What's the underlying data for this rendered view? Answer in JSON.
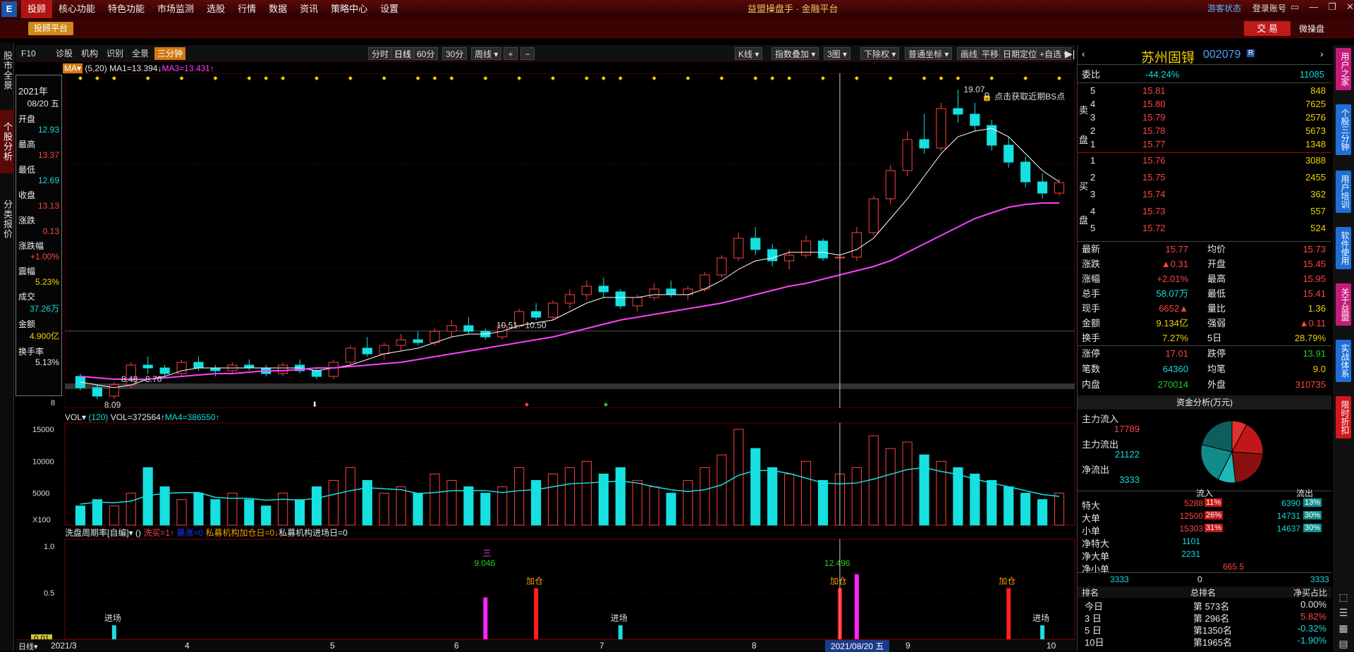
{
  "menubar": {
    "items": [
      "投顾",
      "核心功能",
      "特色功能",
      "市场监测",
      "选股",
      "行情",
      "数据",
      "资讯",
      "策略中心",
      "设置"
    ],
    "title": "益盟操盘手 · 金融平台",
    "guest": "游客状态",
    "login": "登录账号"
  },
  "subbar": {
    "platform": "投顾平台",
    "trade": "交 易",
    "micro": "微操盘"
  },
  "lefttabs": [
    "股市全景",
    "个股分析",
    "分类报价"
  ],
  "toolbar": {
    "left": [
      "F10",
      "诊股",
      "机构",
      "识别",
      "全景",
      "三分钟"
    ],
    "periods": [
      "分时",
      "日线",
      "60分",
      "30分",
      "周线 ▾"
    ],
    "zoom": [
      "+",
      "−"
    ],
    "right": [
      "K线 ▾",
      "指数叠加 ▾",
      "3图 ▾",
      "下除权 ▾",
      "普通坐标 ▾",
      "画线",
      "平移",
      "日期定位",
      "+自选 ▾"
    ]
  },
  "mainchart": {
    "indicator": "MA▾",
    "params": "(5,20)",
    "ma1": "MA1=13.394↓",
    "ma3": "MA3=13.431↑",
    "high_label": "19.07",
    "low_label": "8.09",
    "range1": "8.48 - 8.70",
    "range2": "10.51 - 10.50",
    "bs_tip": "点击获取近期BS点",
    "bottom_tick": "8"
  },
  "infobox": {
    "year": "2021年",
    "date": "08/20 五",
    "fields": [
      {
        "label": "开盘",
        "value": "12.93",
        "cls": "dn"
      },
      {
        "label": "最高",
        "value": "13.37",
        "cls": "up"
      },
      {
        "label": "最低",
        "value": "12.69",
        "cls": "dn"
      },
      {
        "label": "收盘",
        "value": "13.13",
        "cls": "up"
      },
      {
        "label": "涨跌",
        "value": "0.13",
        "cls": "up"
      },
      {
        "label": "涨跌幅",
        "value": "+1.00%",
        "cls": "up"
      },
      {
        "label": "震幅",
        "value": "5.23%",
        "cls": "yl"
      },
      {
        "label": "成交",
        "value": "37.26万",
        "cls": "dn"
      },
      {
        "label": "金额",
        "value": "4.900亿",
        "cls": "yl"
      },
      {
        "label": "换手率",
        "value": "5.13%",
        "cls": "wh"
      }
    ]
  },
  "volpanel": {
    "indicator": "VOL▾",
    "param": "(120)",
    "vol": "VOL=372564↑",
    "ma4": "MA4=386550↑",
    "yticks": [
      "15000",
      "10000",
      "5000",
      "X100"
    ]
  },
  "oscpanel": {
    "title": "洗盘周期率[自编]▾",
    "paren": "()",
    "xm": "洗买=1↑",
    "hidden": "暴涨=0",
    "sm1": "私募机构加仓日=0↓",
    "sm2": "私募机构进场日=0",
    "yticks": [
      "1.0",
      "0.5"
    ],
    "bottom_value": "0.01",
    "label_san": "三",
    "val1": "9.046",
    "val2": "12.496",
    "jc": "加仓",
    "jinchang": "进场"
  },
  "xaxis": {
    "labels": [
      "2021/3",
      "4",
      "5",
      "6",
      "7",
      "8",
      "9",
      "10"
    ],
    "cursor": "2021/08/20 五",
    "left": "日线▾"
  },
  "quote": {
    "name": "苏州固锝",
    "code": "002079",
    "wb_label": "委比",
    "wb": "-44.24%",
    "wb_vol": "11085",
    "asks": [
      {
        "lvl": "5",
        "price": "15.81",
        "vol": "848"
      },
      {
        "lvl": "4",
        "price": "15.80",
        "vol": "7625"
      },
      {
        "lvl": "3",
        "price": "15.79",
        "vol": "2576"
      },
      {
        "lvl": "2",
        "price": "15.78",
        "vol": "5673"
      },
      {
        "lvl": "1",
        "price": "15.77",
        "vol": "1348"
      }
    ],
    "bids": [
      {
        "lvl": "1",
        "price": "15.76",
        "vol": "3088"
      },
      {
        "lvl": "2",
        "price": "15.75",
        "vol": "2455"
      },
      {
        "lvl": "3",
        "price": "15.74",
        "vol": "362"
      },
      {
        "lvl": "4",
        "price": "15.73",
        "vol": "557"
      },
      {
        "lvl": "5",
        "price": "15.72",
        "vol": "524"
      }
    ],
    "sell_label": "卖盘",
    "buy_label": "买盘",
    "stats": [
      [
        "最新",
        "15.77",
        "up",
        "均价",
        "15.73",
        "up"
      ],
      [
        "涨跌",
        "▲0.31",
        "up",
        "开盘",
        "15.45",
        "up"
      ],
      [
        "涨幅",
        "+2.01%",
        "up",
        "最高",
        "15.95",
        "up"
      ],
      [
        "总手",
        "58.07万",
        "dn",
        "最低",
        "15.41",
        "up"
      ],
      [
        "现手",
        "6652▲",
        "up",
        "量比",
        "1.36",
        "yl"
      ],
      [
        "金额",
        "9.134亿",
        "yl",
        "强弱",
        "▲0.11",
        "up"
      ],
      [
        "换手",
        "7.27%",
        "yl",
        "5日",
        "28.79%",
        "yl"
      ]
    ],
    "limits": [
      [
        "涨停",
        "17.01",
        "up",
        "跌停",
        "13.91",
        "gn"
      ],
      [
        "笔数",
        "64360",
        "dn",
        "均笔",
        "9.0",
        "yl"
      ],
      [
        "内盘",
        "270014",
        "gn",
        "外盘",
        "310735",
        "up"
      ]
    ],
    "funds_title": "资金分析(万元)",
    "funds": [
      [
        "主力流入",
        "17789",
        "up"
      ],
      [
        "主力流出",
        "21122",
        "dn"
      ],
      [
        "净流出",
        "3333",
        "dn"
      ]
    ],
    "flow_header": [
      "流入",
      "流出"
    ],
    "flows": [
      {
        "name": "特大",
        "in": "5288",
        "inpct": "11%",
        "out": "6390",
        "outpct": "13%"
      },
      {
        "name": "大单",
        "in": "12500",
        "inpct": "26%",
        "out": "14731",
        "outpct": "30%"
      },
      {
        "name": "小单",
        "in": "15303",
        "inpct": "31%",
        "out": "14637",
        "outpct": "30%"
      }
    ],
    "nets": [
      [
        "净特大",
        "1101"
      ],
      [
        "净大单",
        "2231"
      ],
      [
        "净小单",
        "665.5"
      ]
    ],
    "net_axis": [
      "3333",
      "0",
      "3333"
    ],
    "rank_header": [
      "排名",
      "总排名",
      "净买占比"
    ],
    "ranks": [
      {
        "p": "今日",
        "r": "第 573名",
        "v": "0.00%",
        "c": "wh"
      },
      {
        "p": "3 日",
        "r": "第 296名",
        "v": "5.82%",
        "c": "up"
      },
      {
        "p": "5 日",
        "r": "第1350名",
        "v": "-0.32%",
        "c": "dn"
      },
      {
        "p": "10日",
        "r": "第1965名",
        "v": "-1.90%",
        "c": "dn"
      }
    ]
  },
  "righttabs": [
    {
      "label": "用户之家",
      "color": "#c41b7a"
    },
    {
      "label": "个股三分钟",
      "color": "#1f6fd6"
    },
    {
      "label": "用户培训",
      "color": "#1f6fd6"
    },
    {
      "label": "软件使用",
      "color": "#1f6fd6"
    },
    {
      "label": "关于益盟",
      "color": "#c41b7a"
    },
    {
      "label": "实战体系",
      "color": "#1f6fd6"
    },
    {
      "label": "限时折扣",
      "color": "#d0181e"
    }
  ],
  "chart_data": {
    "type": "candlestick",
    "ylim": [
      8,
      19.5
    ],
    "x_labels": [
      "2021/3",
      "4",
      "5",
      "6",
      "7",
      "8",
      "9",
      "10"
    ],
    "ohlc": [
      [
        8.9,
        9.0,
        8.4,
        8.5
      ],
      [
        8.5,
        8.6,
        8.09,
        8.2
      ],
      [
        8.2,
        8.7,
        8.1,
        8.6
      ],
      [
        8.6,
        9.4,
        8.5,
        9.3
      ],
      [
        9.3,
        9.6,
        9.0,
        9.2
      ],
      [
        9.2,
        9.3,
        8.9,
        9.0
      ],
      [
        9.0,
        9.5,
        8.9,
        9.4
      ],
      [
        9.4,
        9.6,
        9.1,
        9.2
      ],
      [
        9.2,
        9.3,
        8.9,
        9.1
      ],
      [
        9.1,
        9.4,
        9.0,
        9.3
      ],
      [
        9.3,
        9.5,
        9.1,
        9.2
      ],
      [
        9.2,
        9.3,
        8.9,
        9.0
      ],
      [
        9.0,
        9.4,
        8.9,
        9.3
      ],
      [
        9.3,
        9.5,
        9.0,
        9.1
      ],
      [
        9.1,
        9.2,
        8.8,
        8.9
      ],
      [
        8.9,
        9.5,
        8.8,
        9.4
      ],
      [
        9.4,
        10.0,
        9.3,
        9.9
      ],
      [
        9.9,
        10.3,
        9.6,
        9.7
      ],
      [
        9.7,
        10.1,
        9.5,
        10.0
      ],
      [
        10.0,
        10.4,
        9.8,
        10.2
      ],
      [
        10.2,
        10.5,
        10.0,
        10.1
      ],
      [
        10.1,
        10.6,
        10.0,
        10.5
      ],
      [
        10.5,
        10.9,
        10.3,
        10.7
      ],
      [
        10.7,
        11.0,
        10.4,
        10.5
      ],
      [
        10.5,
        10.6,
        10.2,
        10.3
      ],
      [
        10.3,
        10.8,
        10.2,
        10.7
      ],
      [
        10.7,
        11.3,
        10.6,
        11.2
      ],
      [
        11.2,
        11.5,
        10.9,
        11.0
      ],
      [
        11.0,
        11.6,
        10.9,
        11.5
      ],
      [
        11.5,
        12.0,
        11.3,
        11.8
      ],
      [
        11.8,
        12.3,
        11.6,
        12.1
      ],
      [
        12.1,
        12.4,
        11.7,
        11.9
      ],
      [
        11.9,
        12.0,
        11.3,
        11.4
      ],
      [
        11.4,
        11.8,
        11.2,
        11.7
      ],
      [
        11.7,
        12.2,
        11.6,
        12.0
      ],
      [
        12.0,
        12.3,
        11.7,
        11.8
      ],
      [
        11.8,
        12.1,
        11.6,
        12.0
      ],
      [
        12.0,
        12.6,
        11.9,
        12.5
      ],
      [
        12.5,
        13.2,
        12.4,
        13.1
      ],
      [
        13.1,
        14.0,
        13.0,
        13.8
      ],
      [
        13.8,
        14.2,
        13.2,
        13.4
      ],
      [
        13.4,
        13.6,
        12.8,
        13.0
      ],
      [
        13.0,
        13.4,
        12.7,
        13.2
      ],
      [
        13.2,
        13.9,
        13.1,
        13.7
      ],
      [
        13.7,
        13.8,
        13.0,
        13.1
      ],
      [
        13.1,
        13.37,
        12.69,
        13.13
      ],
      [
        13.13,
        14.2,
        13.0,
        14.0
      ],
      [
        14.0,
        15.3,
        13.9,
        15.2
      ],
      [
        15.2,
        16.4,
        15.0,
        16.2
      ],
      [
        16.2,
        17.6,
        16.0,
        17.3
      ],
      [
        17.3,
        18.2,
        16.8,
        17.0
      ],
      [
        17.0,
        18.6,
        16.9,
        18.4
      ],
      [
        18.4,
        19.07,
        17.9,
        18.2
      ],
      [
        18.2,
        18.6,
        17.6,
        17.8
      ],
      [
        17.8,
        18.0,
        16.9,
        17.1
      ],
      [
        17.1,
        17.4,
        16.3,
        16.5
      ],
      [
        16.5,
        16.7,
        15.6,
        15.8
      ],
      [
        15.8,
        16.1,
        15.2,
        15.4
      ],
      [
        15.4,
        15.9,
        15.3,
        15.77
      ]
    ],
    "ma5": [
      8.7,
      8.6,
      8.5,
      8.6,
      8.8,
      8.9,
      9.1,
      9.2,
      9.2,
      9.2,
      9.2,
      9.2,
      9.2,
      9.2,
      9.1,
      9.2,
      9.3,
      9.5,
      9.7,
      9.8,
      9.9,
      10.1,
      10.3,
      10.4,
      10.4,
      10.5,
      10.7,
      10.8,
      10.9,
      11.2,
      11.5,
      11.7,
      11.7,
      11.7,
      11.8,
      11.8,
      11.8,
      12.0,
      12.3,
      12.7,
      13.0,
      13.1,
      13.3,
      13.3,
      13.3,
      13.2,
      13.4,
      13.8,
      14.5,
      15.2,
      16.0,
      16.8,
      17.4,
      17.6,
      17.7,
      17.4,
      16.8,
      16.2,
      15.8
    ],
    "ma20": [
      8.9,
      8.85,
      8.8,
      8.8,
      8.8,
      8.85,
      8.9,
      8.95,
      9.0,
      9.0,
      9.05,
      9.1,
      9.1,
      9.15,
      9.2,
      9.2,
      9.25,
      9.3,
      9.35,
      9.4,
      9.5,
      9.6,
      9.7,
      9.8,
      9.9,
      10.0,
      10.1,
      10.2,
      10.3,
      10.45,
      10.6,
      10.75,
      10.9,
      11.0,
      11.1,
      11.2,
      11.3,
      11.4,
      11.5,
      11.65,
      11.8,
      11.95,
      12.1,
      12.2,
      12.35,
      12.5,
      12.65,
      12.8,
      13.0,
      13.3,
      13.6,
      13.9,
      14.2,
      14.5,
      14.7,
      14.9,
      15.0,
      15.05,
      15.05
    ],
    "volume": [
      3,
      4,
      3,
      5,
      9,
      6,
      4,
      5,
      4,
      5,
      4,
      3,
      5,
      4,
      6,
      7,
      9,
      7,
      5,
      6,
      5,
      8,
      7,
      6,
      5,
      6,
      9,
      7,
      8,
      9,
      10,
      8,
      9,
      7,
      6,
      5,
      7,
      9,
      11,
      15,
      12,
      9,
      8,
      10,
      7,
      8,
      9,
      14,
      12,
      13,
      11,
      10,
      9,
      8,
      7,
      6,
      5,
      4,
      5
    ],
    "volume_ylim": [
      0,
      16000
    ],
    "osc_bars": [
      {
        "i": 2,
        "v": 0.15,
        "c": "cyan"
      },
      {
        "i": 24,
        "v": 0.45,
        "c": "magenta"
      },
      {
        "i": 27,
        "v": 0.55,
        "c": "red"
      },
      {
        "i": 32,
        "v": 0.15,
        "c": "cyan"
      },
      {
        "i": 45,
        "v": 0.55,
        "c": "red"
      },
      {
        "i": 46,
        "v": 0.7,
        "c": "magenta"
      },
      {
        "i": 55,
        "v": 0.55,
        "c": "red"
      },
      {
        "i": 57,
        "v": 0.15,
        "c": "cyan"
      }
    ]
  }
}
